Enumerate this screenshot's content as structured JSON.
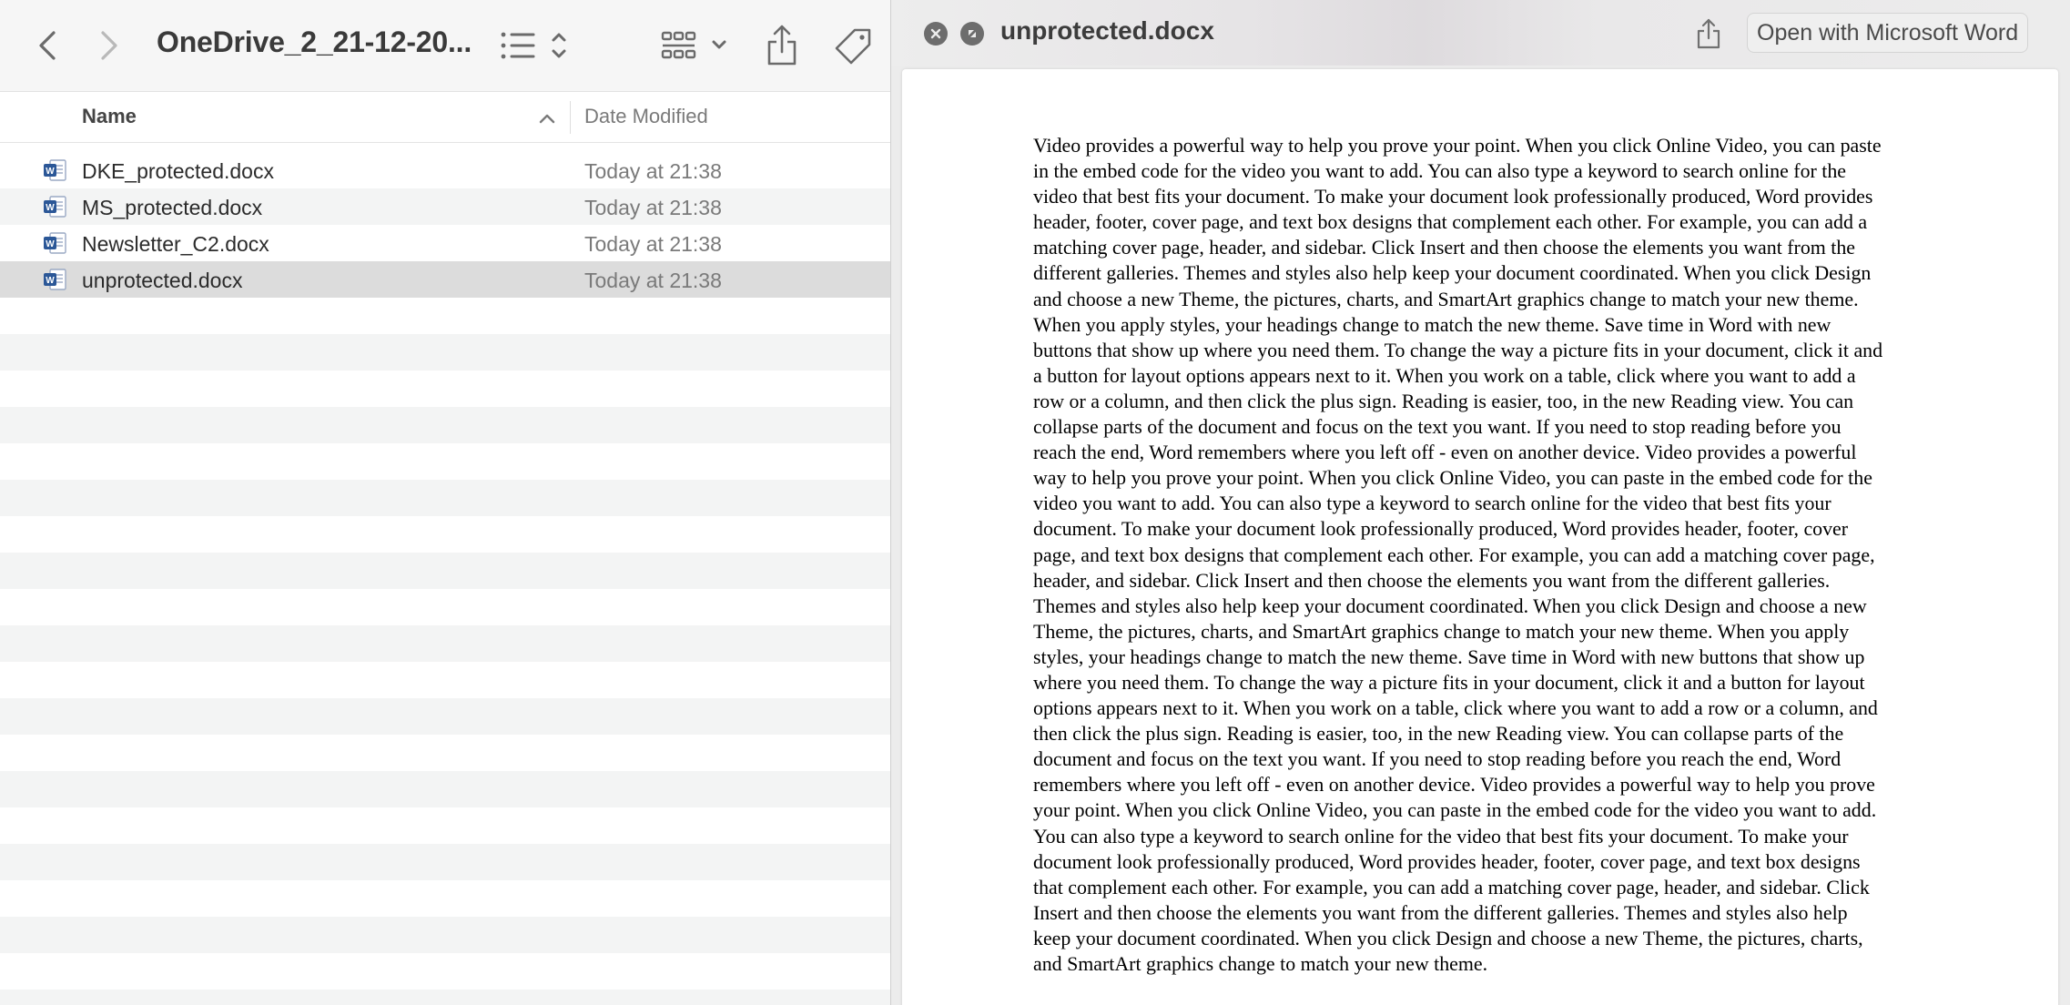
{
  "finder": {
    "folder_title": "OneDrive_2_21-12-20...",
    "columns": {
      "name": "Name",
      "date_modified": "Date Modified"
    },
    "files": [
      {
        "name": "DKE_protected.docx",
        "date": "Today at 21:38",
        "icon": "word-document-icon",
        "selected": false
      },
      {
        "name": "MS_protected.docx",
        "date": "Today at 21:38",
        "icon": "word-document-icon",
        "selected": false
      },
      {
        "name": "Newsletter_C2.docx",
        "date": "Today at 21:38",
        "icon": "word-document-icon",
        "selected": false
      },
      {
        "name": "unprotected.docx",
        "date": "Today at 21:38",
        "icon": "word-document-icon",
        "selected": true
      }
    ],
    "toolbar_icons": [
      "chevron-left-icon",
      "chevron-right-icon",
      "list-view-icon",
      "grid-view-icon",
      "share-icon",
      "tag-icon"
    ]
  },
  "preview": {
    "title": "unprotected.docx",
    "open_with_label": "Open with Microsoft Word",
    "document_text": "Video provides a powerful way to help you prove your point. When you click Online Video, you can paste in the embed code for the video you want to add. You can also type a keyword to search online for the video that best fits your document. To make your document look professionally produced, Word provides header, footer, cover page, and text box designs that complement each other. For example, you can add a matching cover page, header, and sidebar. Click Insert and then choose the elements you want from the different galleries. Themes and styles also help keep your document coordinated. When you click Design and choose a new Theme, the pictures, charts, and SmartArt graphics change to match your new theme. When you apply styles, your headings change to match the new theme. Save time in Word with new buttons that show up where you need them. To change the way a picture fits in your document, click it and a button for layout options appears next to it. When you work on a table, click where you want to add a row or a column, and then click the plus sign. Reading is easier, too, in the new Reading view. You can collapse parts of the document and focus on the text you want. If you need to stop reading before you reach the end, Word remembers where you left off - even on another device. Video provides a powerful way to help you prove your point. When you click Online Video, you can paste in the embed code for the video you want to add. You can also type a keyword to search online for the video that best fits your document. To make your document look professionally produced, Word provides header, footer, cover page, and text box designs that complement each other. For example, you can add a matching cover page, header, and sidebar. Click Insert and then choose the elements you want from the different galleries. Themes and styles also help keep your document coordinated. When you click Design and choose a new Theme, the pictures, charts, and SmartArt graphics change to match your new theme. When you apply styles, your headings change to match the new theme. Save time in Word with new buttons that show up where you need them. To change the way a picture fits in your document, click it and a button for layout options appears next to it. When you work on a table, click where you want to add a row or a column, and then click the plus sign. Reading is easier, too, in the new Reading view. You can collapse parts of the document and focus on the text you want. If you need to stop reading before you reach the end, Word remembers where you left off - even on another device. Video provides a powerful way to help you prove your point. When you click Online Video, you can paste in the embed code for the video you want to add. You can also type a keyword to search online for the video that best fits your document. To make your document look professionally produced, Word provides header, footer, cover page, and text box designs that complement each other. For example, you can add a matching cover page, header, and sidebar. Click Insert and then choose the elements you want from the different galleries. Themes and styles also help keep your document coordinated. When you click Design and choose a new Theme, the pictures, charts, and SmartArt graphics change to match your new theme."
  },
  "colors": {
    "word_blue": "#2b5797",
    "selected_row": "#dcdcdc",
    "alt_row": "#f3f4f4"
  }
}
